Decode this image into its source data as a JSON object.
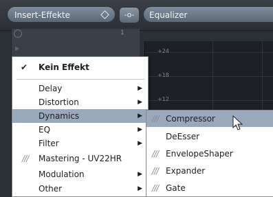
{
  "header": {
    "insert_label": "Insert-Effekte",
    "plugin_label": "Equalizer",
    "link_symbol": "-o-"
  },
  "panel": {
    "slot_number": "1"
  },
  "graph": {
    "y_labels": [
      "+24",
      "+18",
      "+12"
    ]
  },
  "menu": {
    "items": [
      {
        "label": "Kein Effekt",
        "checked": true
      },
      {
        "label": "Delay",
        "submenu": true
      },
      {
        "label": "Distortion",
        "submenu": true
      },
      {
        "label": "Dynamics",
        "submenu": true,
        "highlighted": true
      },
      {
        "label": "EQ",
        "submenu": true
      },
      {
        "label": "Filter",
        "submenu": true
      },
      {
        "label": "Mastering - UV22HR",
        "plugin": true
      },
      {
        "label": "Modulation",
        "submenu": true
      },
      {
        "label": "Other",
        "submenu": true
      }
    ],
    "checkmark": "✔",
    "hatch": "///",
    "arrow": "▶"
  },
  "submenu": {
    "items": [
      {
        "label": "Compressor",
        "plugin": true,
        "highlighted": true
      },
      {
        "label": "DeEsser"
      },
      {
        "label": "EnvelopeShaper",
        "plugin": true
      },
      {
        "label": "Expander",
        "plugin": true
      },
      {
        "label": "Gate",
        "plugin": true
      }
    ]
  },
  "colors": {
    "highlight": "#9aa8bc",
    "pill": "#6d7a88"
  },
  "icons": [
    "diamond-icon",
    "link-icon",
    "power-icon",
    "checkmark-icon",
    "submenu-arrow-icon",
    "plugin-hatch-icon",
    "mouse-cursor-icon"
  ]
}
